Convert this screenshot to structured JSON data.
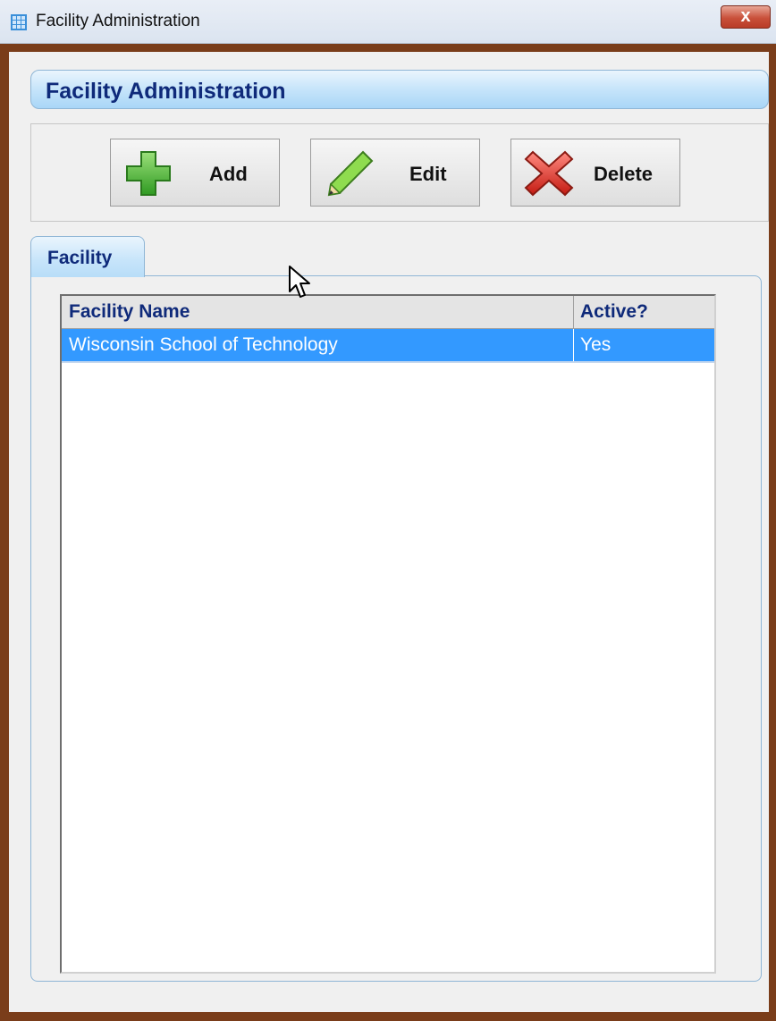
{
  "window": {
    "title": "Facility Administration",
    "close_label": "x"
  },
  "header": {
    "title": "Facility Administration"
  },
  "toolbar": {
    "add_label": "Add",
    "edit_label": "Edit",
    "delete_label": "Delete"
  },
  "tabs": [
    {
      "label": "Facility",
      "selected": true
    }
  ],
  "grid": {
    "columns": [
      "Facility Name",
      "Active?"
    ],
    "rows": [
      {
        "name": "Wisconsin School of Technology",
        "active": "Yes",
        "selected": true
      }
    ]
  },
  "icons": {
    "app": "grid-app-icon",
    "add": "green-plus-icon",
    "edit": "pencil-icon",
    "delete": "red-x-icon",
    "cursor": "mouse-pointer-icon"
  },
  "colors": {
    "selection": "#3399ff",
    "header_text": "#0f2a7a",
    "window_frame": "#7a3d1a"
  }
}
